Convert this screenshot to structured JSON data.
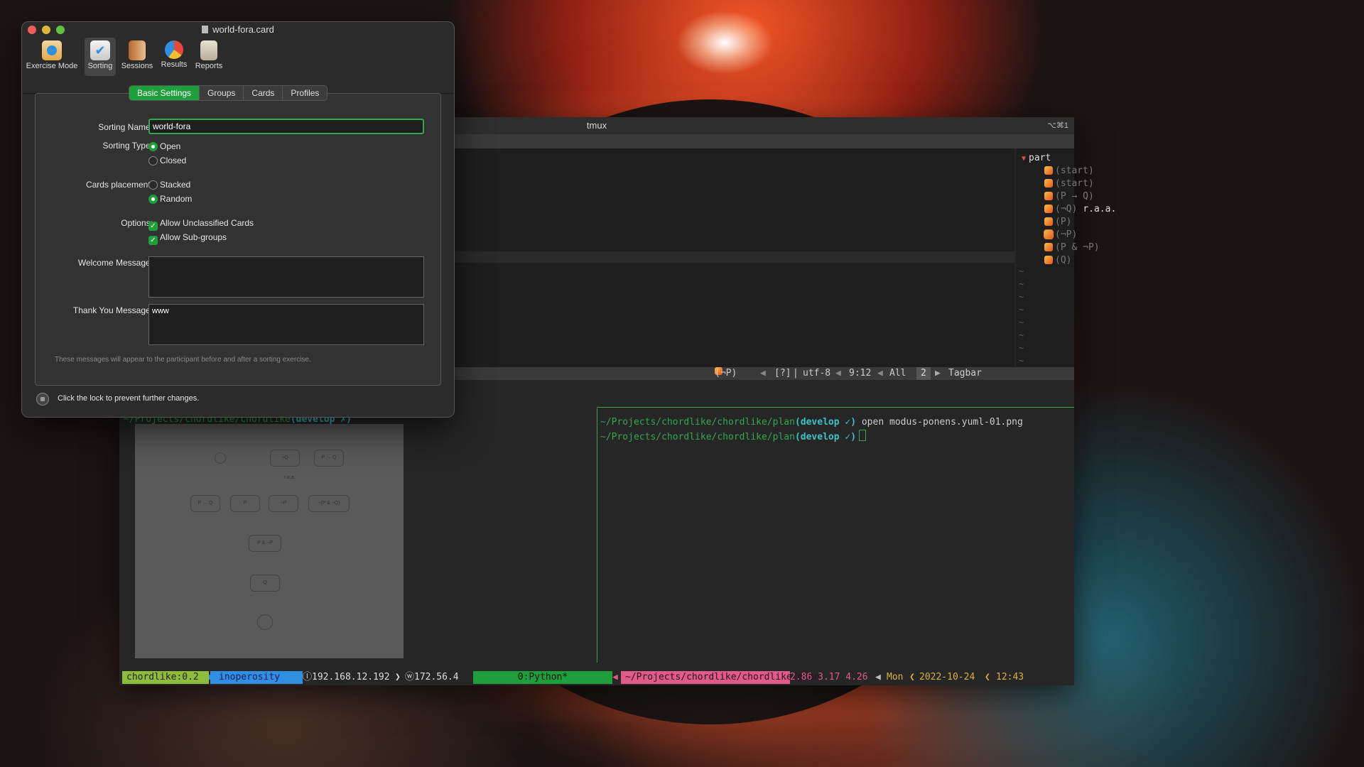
{
  "dialog": {
    "title": "world-fora.card",
    "toolbar": [
      {
        "label": "Exercise Mode",
        "icon": "exercise-mode-icon"
      },
      {
        "label": "Sorting",
        "icon": "sorting-icon",
        "selected": true
      },
      {
        "label": "Sessions",
        "icon": "sessions-icon"
      },
      {
        "label": "Results",
        "icon": "results-icon"
      },
      {
        "label": "Reports",
        "icon": "reports-icon"
      }
    ],
    "tabs": [
      "Basic Settings",
      "Groups",
      "Cards",
      "Profiles"
    ],
    "active_tab": "Basic Settings",
    "sorting_name_label": "Sorting Name:",
    "sorting_name_value": "world-fora",
    "sorting_type_label": "Sorting Type:",
    "sorting_type_options": [
      "Open",
      "Closed"
    ],
    "sorting_type_selected": "Open",
    "cards_placement_label": "Cards placement:",
    "cards_placement_options": [
      "Stacked",
      "Random"
    ],
    "cards_placement_selected": "Random",
    "options_label": "Options:",
    "options": [
      {
        "label": "Allow Unclassified Cards",
        "checked": true
      },
      {
        "label": "Allow Sub-groups",
        "checked": true
      }
    ],
    "welcome_label": "Welcome Message:",
    "welcome_value": "",
    "thankyou_label": "Thank You Message:",
    "thankyou_value": "www",
    "note": "These messages will appear to the participant before and after a sorting exercise.",
    "lock_text": "Click the lock to prevent further changes."
  },
  "tmux": {
    "title": "tmux",
    "shortcut": "⌥⌘1",
    "tagbar": {
      "root": "part",
      "items": [
        {
          "label": "(start)"
        },
        {
          "label": "(start)"
        },
        {
          "label": "(P → Q)"
        },
        {
          "label": "(¬Q)",
          "extra": "r.a.a."
        },
        {
          "label": "(P)"
        },
        {
          "label": "(¬P)",
          "selected": true
        },
        {
          "label": "(P & ¬P)"
        },
        {
          "label": "(Q)"
        }
      ]
    },
    "vim_status": {
      "tag": "(¬P)",
      "help": "[?]",
      "encoding": "utf-8",
      "position": "9:12",
      "scroll": "All",
      "window_num": "2",
      "plugin": "Tagbar"
    },
    "left_pane_prompt": {
      "path": "~/Projects/chordlike/chordlike",
      "branch": "(develop ✗)"
    },
    "terminal_lines": [
      {
        "path": "~/Projects/chordlike/chordlike/plan",
        "branch": "(develop ✓)",
        "cmd": "open modus-ponens.yuml-01.png"
      },
      {
        "path": "~/Projects/chordlike/chordlike/plan",
        "branch": "(develop ✓)",
        "cmd": ""
      }
    ],
    "diagram_nodes": [
      "¬Q",
      "P → Q",
      "P → Q",
      "P",
      "¬P",
      "¬(P & ¬Q)",
      "P & ¬P",
      "Q"
    ],
    "diagram_edge_label": "r.a.a.",
    "statusbar": {
      "session": "chordlike:0.2",
      "user": "inoperosity",
      "local_ip": "ⓛ192.168.12.192",
      "wan_ip": "ⓦ172.56.4",
      "window": "0:Python*",
      "cwd": "~/Projects/chordlike/chordlike/plan",
      "load": "2.86 3.17 4.26",
      "day": "Mon",
      "date": "2022-10-24",
      "time": "12:43"
    },
    "colors": {
      "green": "#2fa84f",
      "blue": "#2f8fe0",
      "pink": "#e05a8a",
      "yellow": "#d8b23a"
    }
  }
}
